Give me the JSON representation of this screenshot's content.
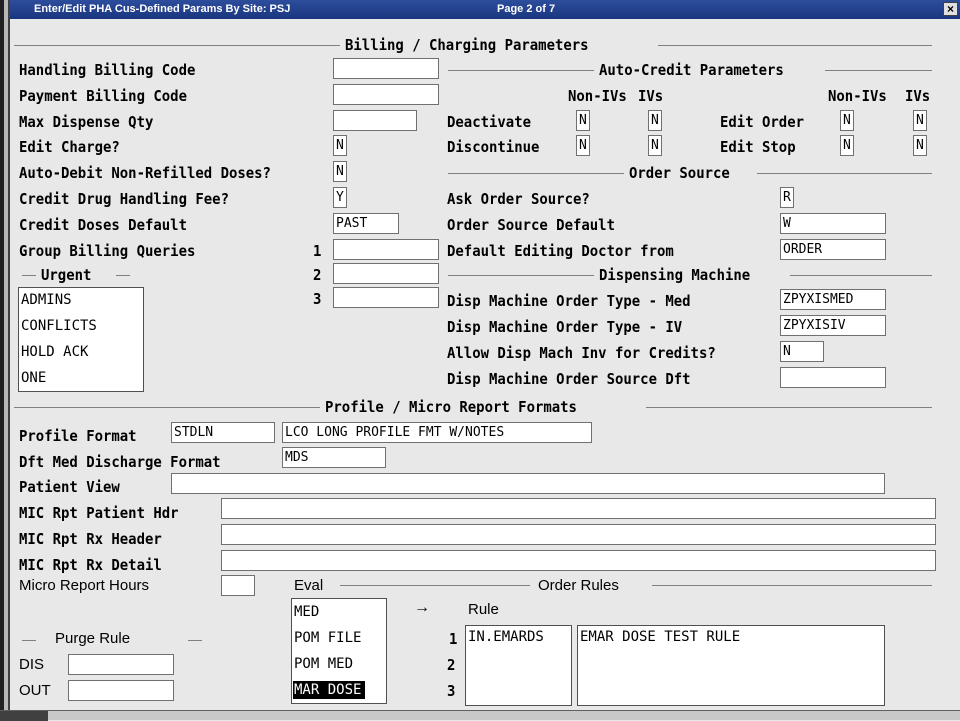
{
  "window": {
    "title": "Enter/Edit PHA Cus-Defined Params By Site: PSJ",
    "page": "Page 2 of 7",
    "close": "×"
  },
  "sections": {
    "billing": "Billing / Charging Parameters",
    "auto_credit": "Auto-Credit Parameters",
    "order_source": "Order Source",
    "dispensing": "Dispensing Machine",
    "urgent": "Urgent",
    "profile": "Profile / Micro Report Formats",
    "eval": "Eval",
    "order_rules": "Order Rules",
    "purge": "Purge Rule"
  },
  "billing": {
    "handling_billing_code": {
      "label": "Handling Billing Code",
      "value": ""
    },
    "payment_billing_code": {
      "label": "Payment Billing Code",
      "value": ""
    },
    "max_dispense_qty": {
      "label": "Max Dispense Qty",
      "value": ""
    },
    "edit_charge": {
      "label": "Edit Charge?",
      "value": "N"
    },
    "auto_debit": {
      "label": "Auto-Debit Non-Refilled Doses?",
      "value": "N"
    },
    "credit_drug_fee": {
      "label": "Credit Drug Handling Fee?",
      "value": "Y"
    },
    "credit_doses_default": {
      "label": "Credit Doses Default",
      "value": "PAST"
    },
    "group_billing_queries": {
      "label": "Group Billing Queries",
      "nums": [
        "1",
        "2",
        "3"
      ],
      "values": [
        "",
        "",
        ""
      ]
    }
  },
  "auto_credit": {
    "col_nonivs": "Non-IVs",
    "col_ivs": "IVs",
    "deactivate": {
      "label": "Deactivate",
      "nonivs": "N",
      "ivs": "N"
    },
    "discontinue": {
      "label": "Discontinue",
      "nonivs": "N",
      "ivs": "N"
    },
    "edit_order": {
      "label": "Edit Order",
      "nonivs": "N",
      "ivs": "N"
    },
    "edit_stop": {
      "label": "Edit Stop",
      "nonivs": "N",
      "ivs": "N"
    }
  },
  "order_source": {
    "ask": {
      "label": "Ask Order Source?",
      "value": "R"
    },
    "default": {
      "label": "Order Source Default",
      "value": "W"
    },
    "editing_doctor": {
      "label": "Default Editing Doctor from",
      "value": "ORDER"
    }
  },
  "dispensing": {
    "type_med": {
      "label": "Disp Machine Order Type - Med",
      "value": "ZPYXISMED"
    },
    "type_iv": {
      "label": "Disp Machine Order Type - IV",
      "value": "ZPYXISIV"
    },
    "allow_inv": {
      "label": "Allow Disp Mach Inv for Credits?",
      "value": "N"
    },
    "source_dft": {
      "label": "Disp Machine Order Source Dft",
      "value": ""
    }
  },
  "urgent_items": [
    "ADMINS",
    "CONFLICTS",
    "HOLD ACK",
    "ONE"
  ],
  "profile": {
    "profile_format": {
      "label": "Profile Format",
      "code": "STDLN",
      "desc": "LCO LONG PROFILE FMT W/NOTES"
    },
    "dft_med_discharge": {
      "label": "Dft Med Discharge Format",
      "value": "MDS"
    },
    "patient_view": {
      "label": "Patient View",
      "value": ""
    },
    "mic_patient_hdr": {
      "label": "MIC Rpt Patient Hdr",
      "value": ""
    },
    "mic_rx_header": {
      "label": "MIC Rpt Rx Header",
      "value": ""
    },
    "mic_rx_detail": {
      "label": "MIC Rpt Rx Detail",
      "value": ""
    },
    "micro_report_hours": {
      "label": "Micro Report Hours",
      "value": ""
    }
  },
  "eval_items": [
    "MED",
    "POM FILE",
    "POM MED",
    "MAR DOSE"
  ],
  "eval_selected": "MAR DOSE",
  "order_rules": {
    "arrow": "→",
    "rule_header": "Rule",
    "nums": [
      "1",
      "2",
      "3"
    ],
    "codes": [
      "IN.EMARDS"
    ],
    "descriptions": [
      "EMAR DOSE TEST RULE"
    ]
  },
  "purge": {
    "dis": {
      "label": "DIS",
      "value": ""
    },
    "out": {
      "label": "OUT",
      "value": ""
    }
  }
}
